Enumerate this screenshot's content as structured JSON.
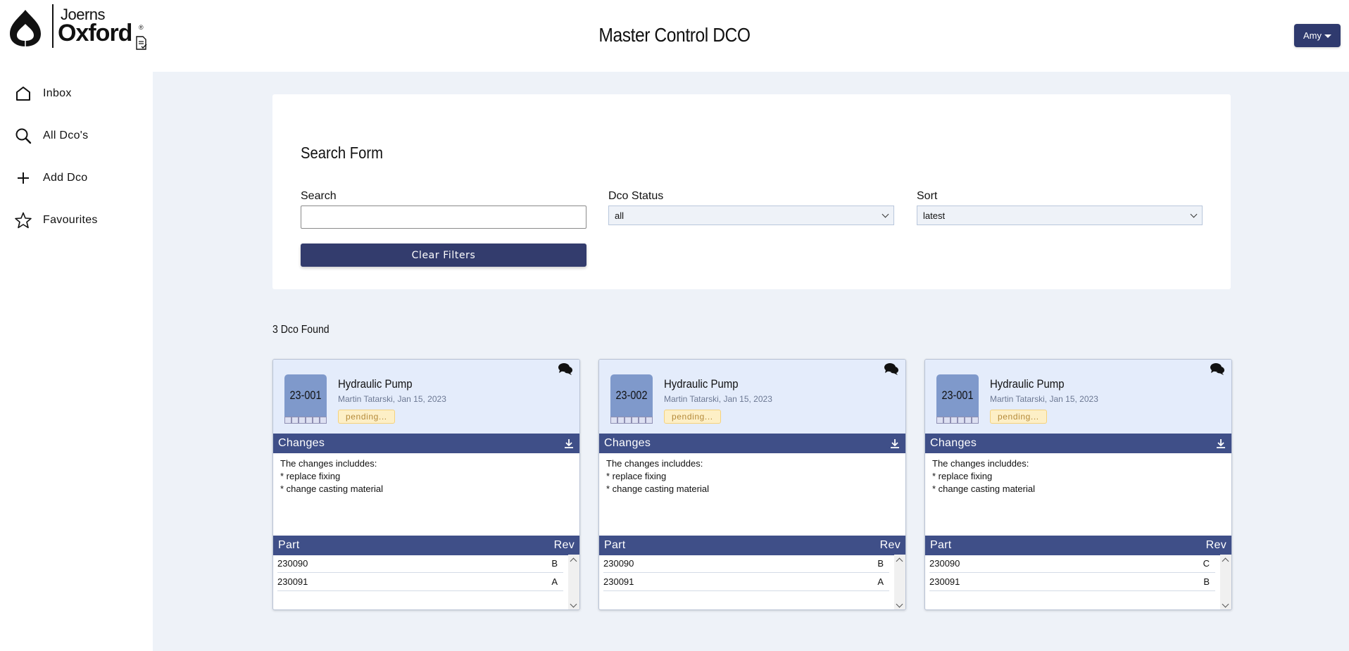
{
  "header": {
    "logo_top": "Joerns",
    "logo_bottom": "Oxford",
    "logo_reg": "®",
    "title": "Master Control DCO",
    "user_label": "Amy"
  },
  "sidebar": {
    "items": [
      {
        "label": "Inbox",
        "icon": "home-icon"
      },
      {
        "label": "All Dco's",
        "icon": "search-icon"
      },
      {
        "label": "Add Dco",
        "icon": "plus-icon"
      },
      {
        "label": "Favourites",
        "icon": "star-icon"
      }
    ]
  },
  "search_form": {
    "title": "Search Form",
    "search_label": "Search",
    "search_value": "",
    "search_placeholder": "",
    "status_label": "Dco Status",
    "status_value": "all",
    "sort_label": "Sort",
    "sort_value": "latest",
    "clear_label": "Clear Filters"
  },
  "results": {
    "count_label": "3 Dco Found",
    "changes_label": "Changes",
    "part_header": "Part",
    "rev_header": "Rev",
    "cards": [
      {
        "number": "23-001",
        "title": "Hydraulic Pump",
        "meta": "Martin Tatarski,  Jan 15, 2023",
        "status": "pending...",
        "changes": "The changes includdes:\n* replace fixing\n* change casting material",
        "parts": [
          {
            "part": "230090",
            "rev": "B"
          },
          {
            "part": "230091",
            "rev": "A"
          }
        ]
      },
      {
        "number": "23-002",
        "title": "Hydraulic Pump",
        "meta": "Martin Tatarski,  Jan 15, 2023",
        "status": "pending...",
        "changes": "The changes includdes:\n* replace fixing\n* change casting material",
        "parts": [
          {
            "part": "230090",
            "rev": "B"
          },
          {
            "part": "230091",
            "rev": "A"
          }
        ]
      },
      {
        "number": "23-001",
        "title": "Hydraulic Pump",
        "meta": "Martin Tatarski,  Jan 15, 2023",
        "status": "pending...",
        "changes": "The changes includdes:\n* replace fixing\n* change casting material",
        "parts": [
          {
            "part": "230090",
            "rev": "C"
          },
          {
            "part": "230091",
            "rev": "B"
          }
        ]
      }
    ]
  },
  "colors": {
    "primary": "#333c6d",
    "section_bar": "#3f4f88",
    "card_top": "#e4ecfb",
    "badge": "#7f99cb",
    "pending_bg": "#fdefc6",
    "pending_text": "#b58a3a",
    "main_bg": "#eef2f8"
  }
}
